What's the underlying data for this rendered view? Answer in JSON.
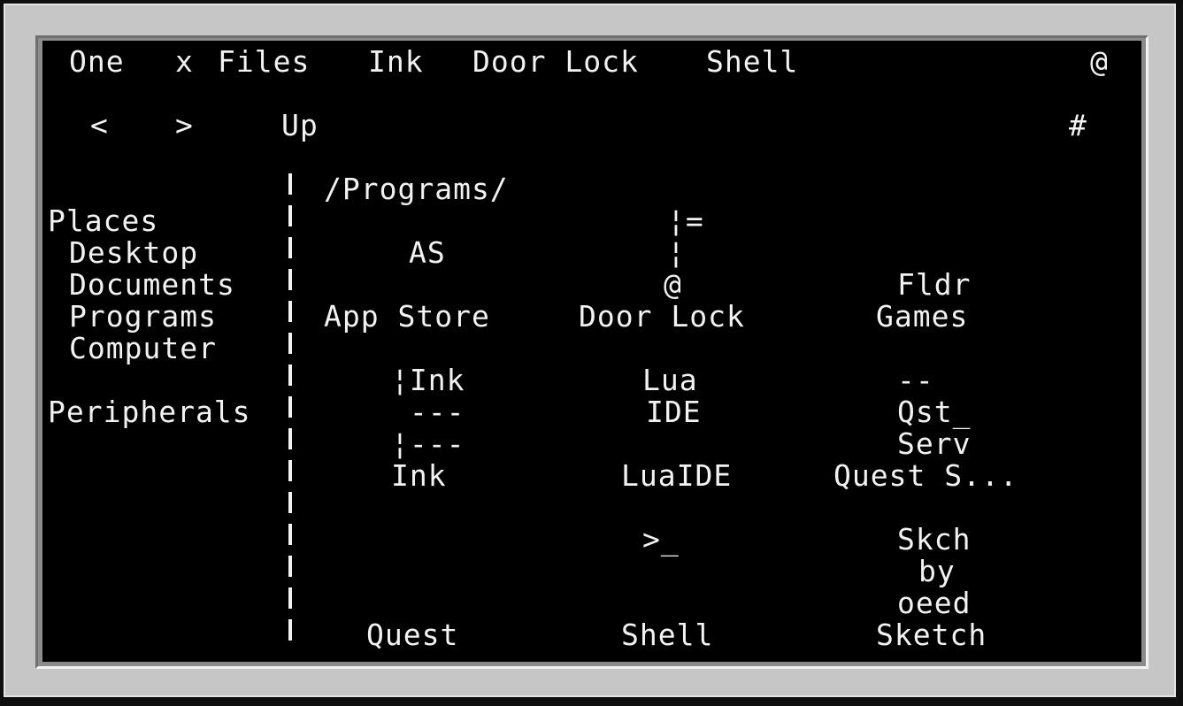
{
  "menu_bar": {
    "one_label": "One",
    "close_label": "x",
    "files_label": "Files",
    "ink_label": "Ink",
    "door_lock_label": "Door Lock",
    "shell_label": "Shell",
    "at_label": "@"
  },
  "toolbar": {
    "back_label": "<",
    "forward_label": ">",
    "up_label": "Up",
    "hash_label": "#"
  },
  "sidebar": {
    "places_heading": "Places",
    "items": [
      {
        "label": "Desktop"
      },
      {
        "label": "Documents"
      },
      {
        "label": "Programs"
      },
      {
        "label": "Computer"
      }
    ],
    "peripherals_heading": "Peripherals"
  },
  "path": "/Programs/",
  "files": [
    {
      "icon_lines": [
        "",
        "AS",
        ""
      ],
      "label": "App Store"
    },
    {
      "icon_lines": [
        "¦=",
        "¦",
        "@"
      ],
      "label": "Door Lock"
    },
    {
      "icon_lines": [
        "",
        "",
        "Fldr"
      ],
      "label": "Games"
    },
    {
      "icon_lines": [
        "¦Ink",
        " ---",
        "¦---"
      ],
      "label": "Ink"
    },
    {
      "icon_lines": [
        "Lua",
        "IDE",
        ""
      ],
      "label": "LuaIDE"
    },
    {
      "icon_lines": [
        "--",
        "Qst_",
        "Serv"
      ],
      "label": "Quest S..."
    },
    {
      "icon_lines": [
        "",
        "",
        ""
      ],
      "label": "Quest"
    },
    {
      "icon_lines": [
        ">_",
        "",
        ""
      ],
      "label": "Shell"
    },
    {
      "icon_lines": [
        "Skch",
        "by",
        "oeed"
      ],
      "label": "Sketch"
    }
  ]
}
